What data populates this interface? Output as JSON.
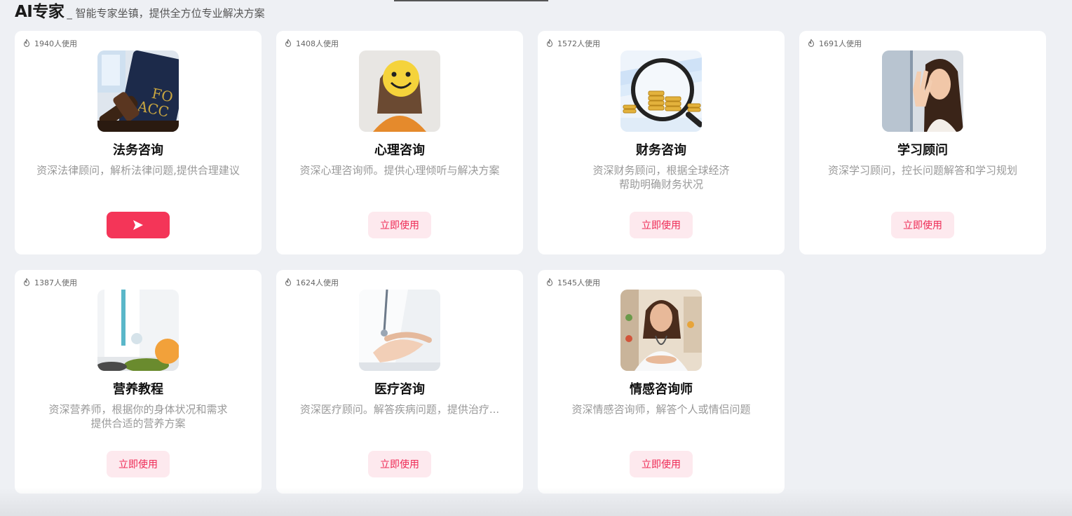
{
  "header": {
    "title": "AI专家",
    "subtitle": "_ 智能专家坐镇，提供全方位专业解决方案"
  },
  "colors": {
    "accent": "#f43558",
    "accent_soft": "#fde9ee",
    "background": "#eef0f4"
  },
  "cards": [
    {
      "usage": "1940人使用",
      "title": "法务咨询",
      "desc": "资深法律顾问，解析法律问题,提供合理建议",
      "button": "",
      "active": true,
      "image": "legal"
    },
    {
      "usage": "1408人使用",
      "title": "心理咨询",
      "desc": "资深心理咨询师。提供心理倾听与解决方案",
      "button": "立即使用",
      "active": false,
      "image": "psychology"
    },
    {
      "usage": "1572人使用",
      "title": "财务咨询",
      "desc": "资深财务顾问，根据全球经济\n帮助明确财务状况",
      "button": "立即使用",
      "active": false,
      "image": "finance"
    },
    {
      "usage": "1691人使用",
      "title": "学习顾问",
      "desc": "资深学习顾问，控长问题解答和学习规划",
      "button": "立即使用",
      "active": false,
      "image": "study"
    },
    {
      "usage": "1387人使用",
      "title": "营养教程",
      "desc": "资深营养师，根据你的身体状况和需求\n提供合适的营养方案",
      "button": "立即使用",
      "active": false,
      "image": "nutrition"
    },
    {
      "usage": "1624人使用",
      "title": "医疗咨询",
      "desc": "资深医疗顾问。解答疾病问题，提供治疗...",
      "button": "立即使用",
      "active": false,
      "image": "medical"
    },
    {
      "usage": "1545人使用",
      "title": "情感咨询师",
      "desc": "资深情感咨询师，解答个人或情侣问题",
      "button": "立即使用",
      "active": false,
      "image": "emotion"
    }
  ]
}
